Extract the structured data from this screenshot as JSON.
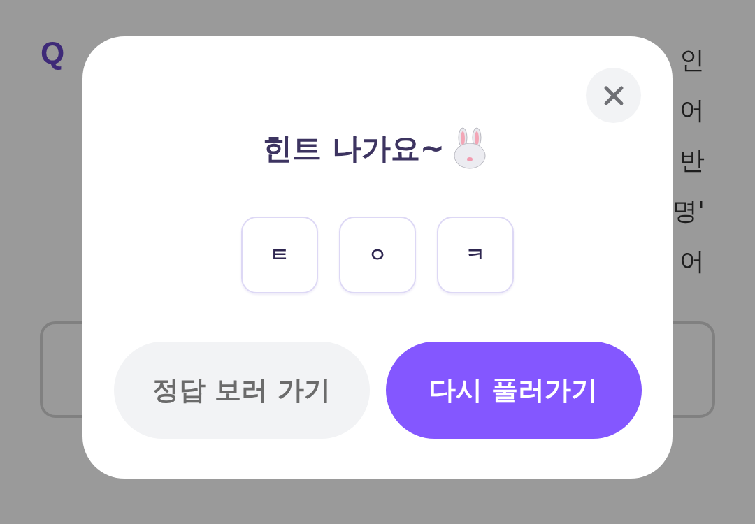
{
  "background": {
    "question_mark": "Q",
    "text_fragments": [
      "인",
      "어",
      "반",
      "명'",
      "어"
    ]
  },
  "modal": {
    "title": "힌트 나가요~",
    "hint_letters": [
      "ㅌ",
      "ㅇ",
      "ㅋ"
    ],
    "buttons": [
      {
        "label": "정답 보러 가기",
        "kind": "secondary"
      },
      {
        "label": "다시 풀러가기",
        "kind": "primary"
      }
    ]
  }
}
